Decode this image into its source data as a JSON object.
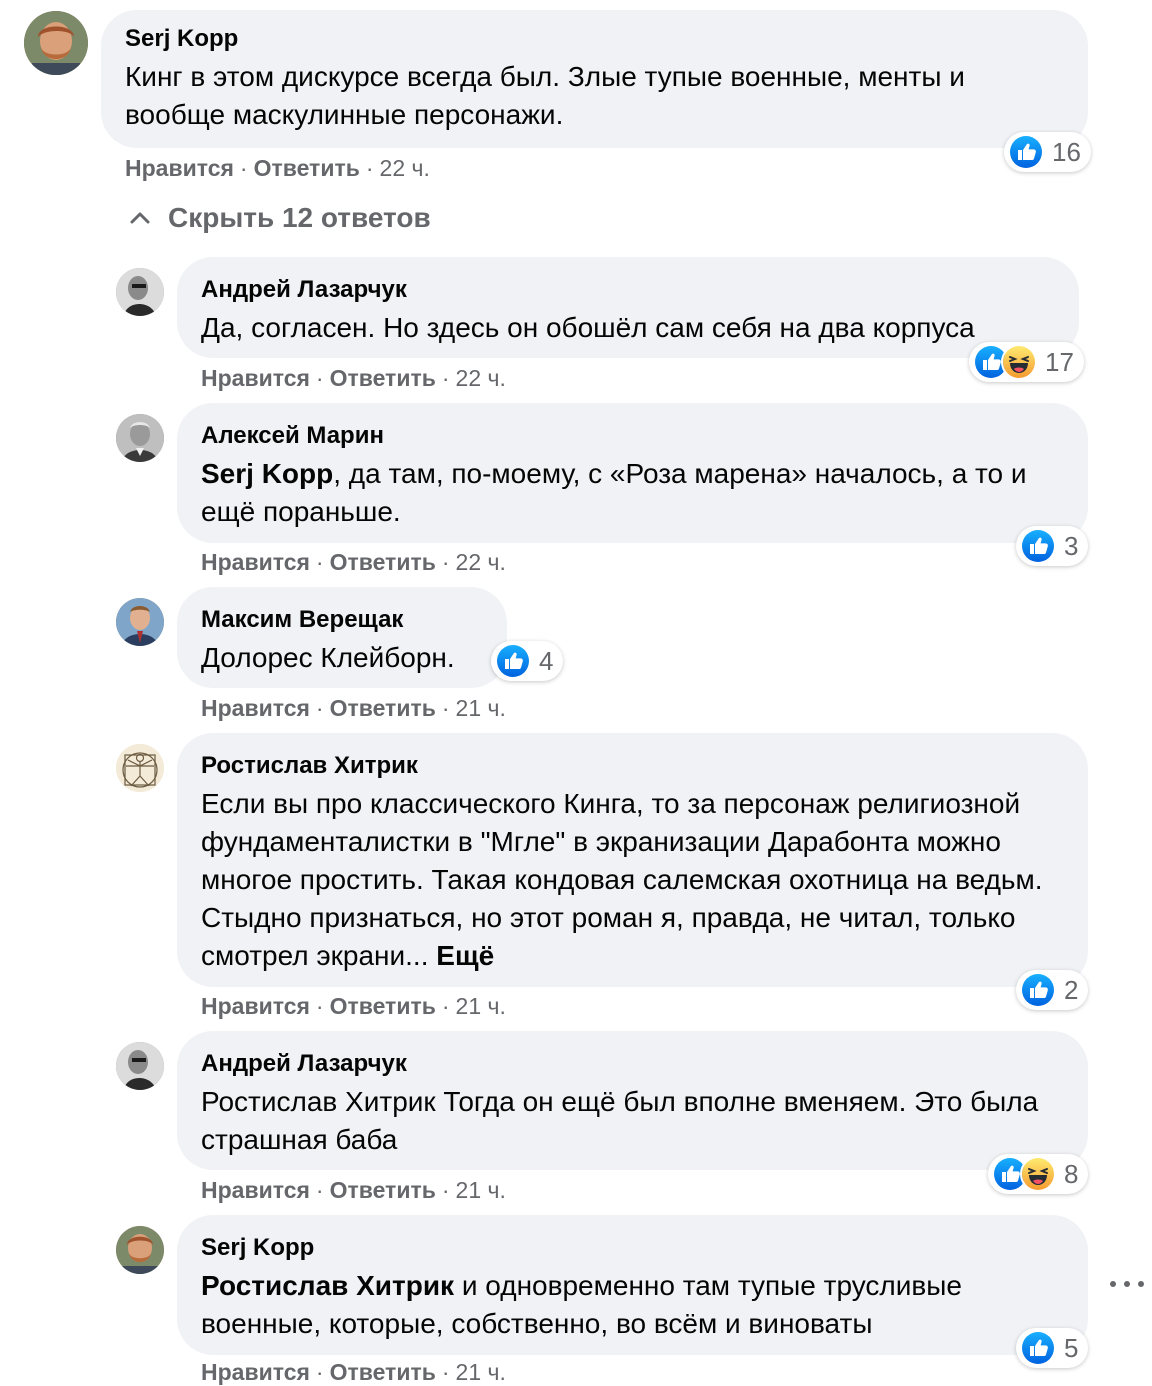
{
  "comment": {
    "author": "Serj Kopp",
    "text": "Кинг в этом дискурсе всегда был. Злые тупые военные, менты и вообще маскулинные персонажи.",
    "reaction_count": "16",
    "like_label": "Нравится",
    "reply_label": "Ответить",
    "time": "22 ч."
  },
  "toggle_replies": {
    "label": "Скрыть 12 ответов",
    "icon": "chevron-up-icon"
  },
  "replies": [
    {
      "author": "Андрей Лазарчук",
      "text": "Да, согласен. Но здесь он обошёл сам себя на два корпуса",
      "reactions": [
        "like",
        "haha"
      ],
      "reaction_count": "17",
      "like_label": "Нравится",
      "reply_label": "Ответить",
      "time": "22 ч."
    },
    {
      "author": "Алексей Марин",
      "mention": "Serj Kopp",
      "text": ", да там, по-моему, с «Роза марена» началось, а то и ещё пораньше.",
      "reactions": [
        "like"
      ],
      "reaction_count": "3",
      "like_label": "Нравится",
      "reply_label": "Ответить",
      "time": "22 ч."
    },
    {
      "author": "Максим Верещак",
      "text": "Долорес Клейборн.",
      "reactions": [
        "like"
      ],
      "reaction_count": "4",
      "like_label": "Нравится",
      "reply_label": "Ответить",
      "time": "21 ч."
    },
    {
      "author": "Ростислав Хитрик",
      "text": "Если вы про классического Кинга, то за персонаж религиозной фундаменталистки в \"Мгле\" в экранизации Дарабонта можно многое простить. Такая кондовая салемская охотница на ведьм. Стыдно признаться, но этот роман я, правда, не читал, только смотрел экрани...",
      "see_more": "Ещё",
      "reactions": [
        "like"
      ],
      "reaction_count": "2",
      "like_label": "Нравится",
      "reply_label": "Ответить",
      "time": "21 ч."
    },
    {
      "author": "Андрей Лазарчук",
      "text": "Ростислав Хитрик Тогда он ещё был вполне вменяем. Это была страшная баба",
      "reactions": [
        "like",
        "haha"
      ],
      "reaction_count": "8",
      "like_label": "Нравится",
      "reply_label": "Ответить",
      "time": "21 ч."
    },
    {
      "author": "Serj Kopp",
      "mention": "Ростислав Хитрик",
      "text": " и одновременно там тупые трусливые военные, которые, собственно, во всём и виноваты",
      "reactions": [
        "like"
      ],
      "reaction_count": "5",
      "like_label": "Нравится",
      "reply_label": "Ответить",
      "time": "21 ч."
    }
  ],
  "colors": {
    "bubble": "#f0f2f5",
    "secondary_text": "#65676b",
    "like_blue": "#1877f2",
    "haha_yellow": "#f7b125"
  }
}
